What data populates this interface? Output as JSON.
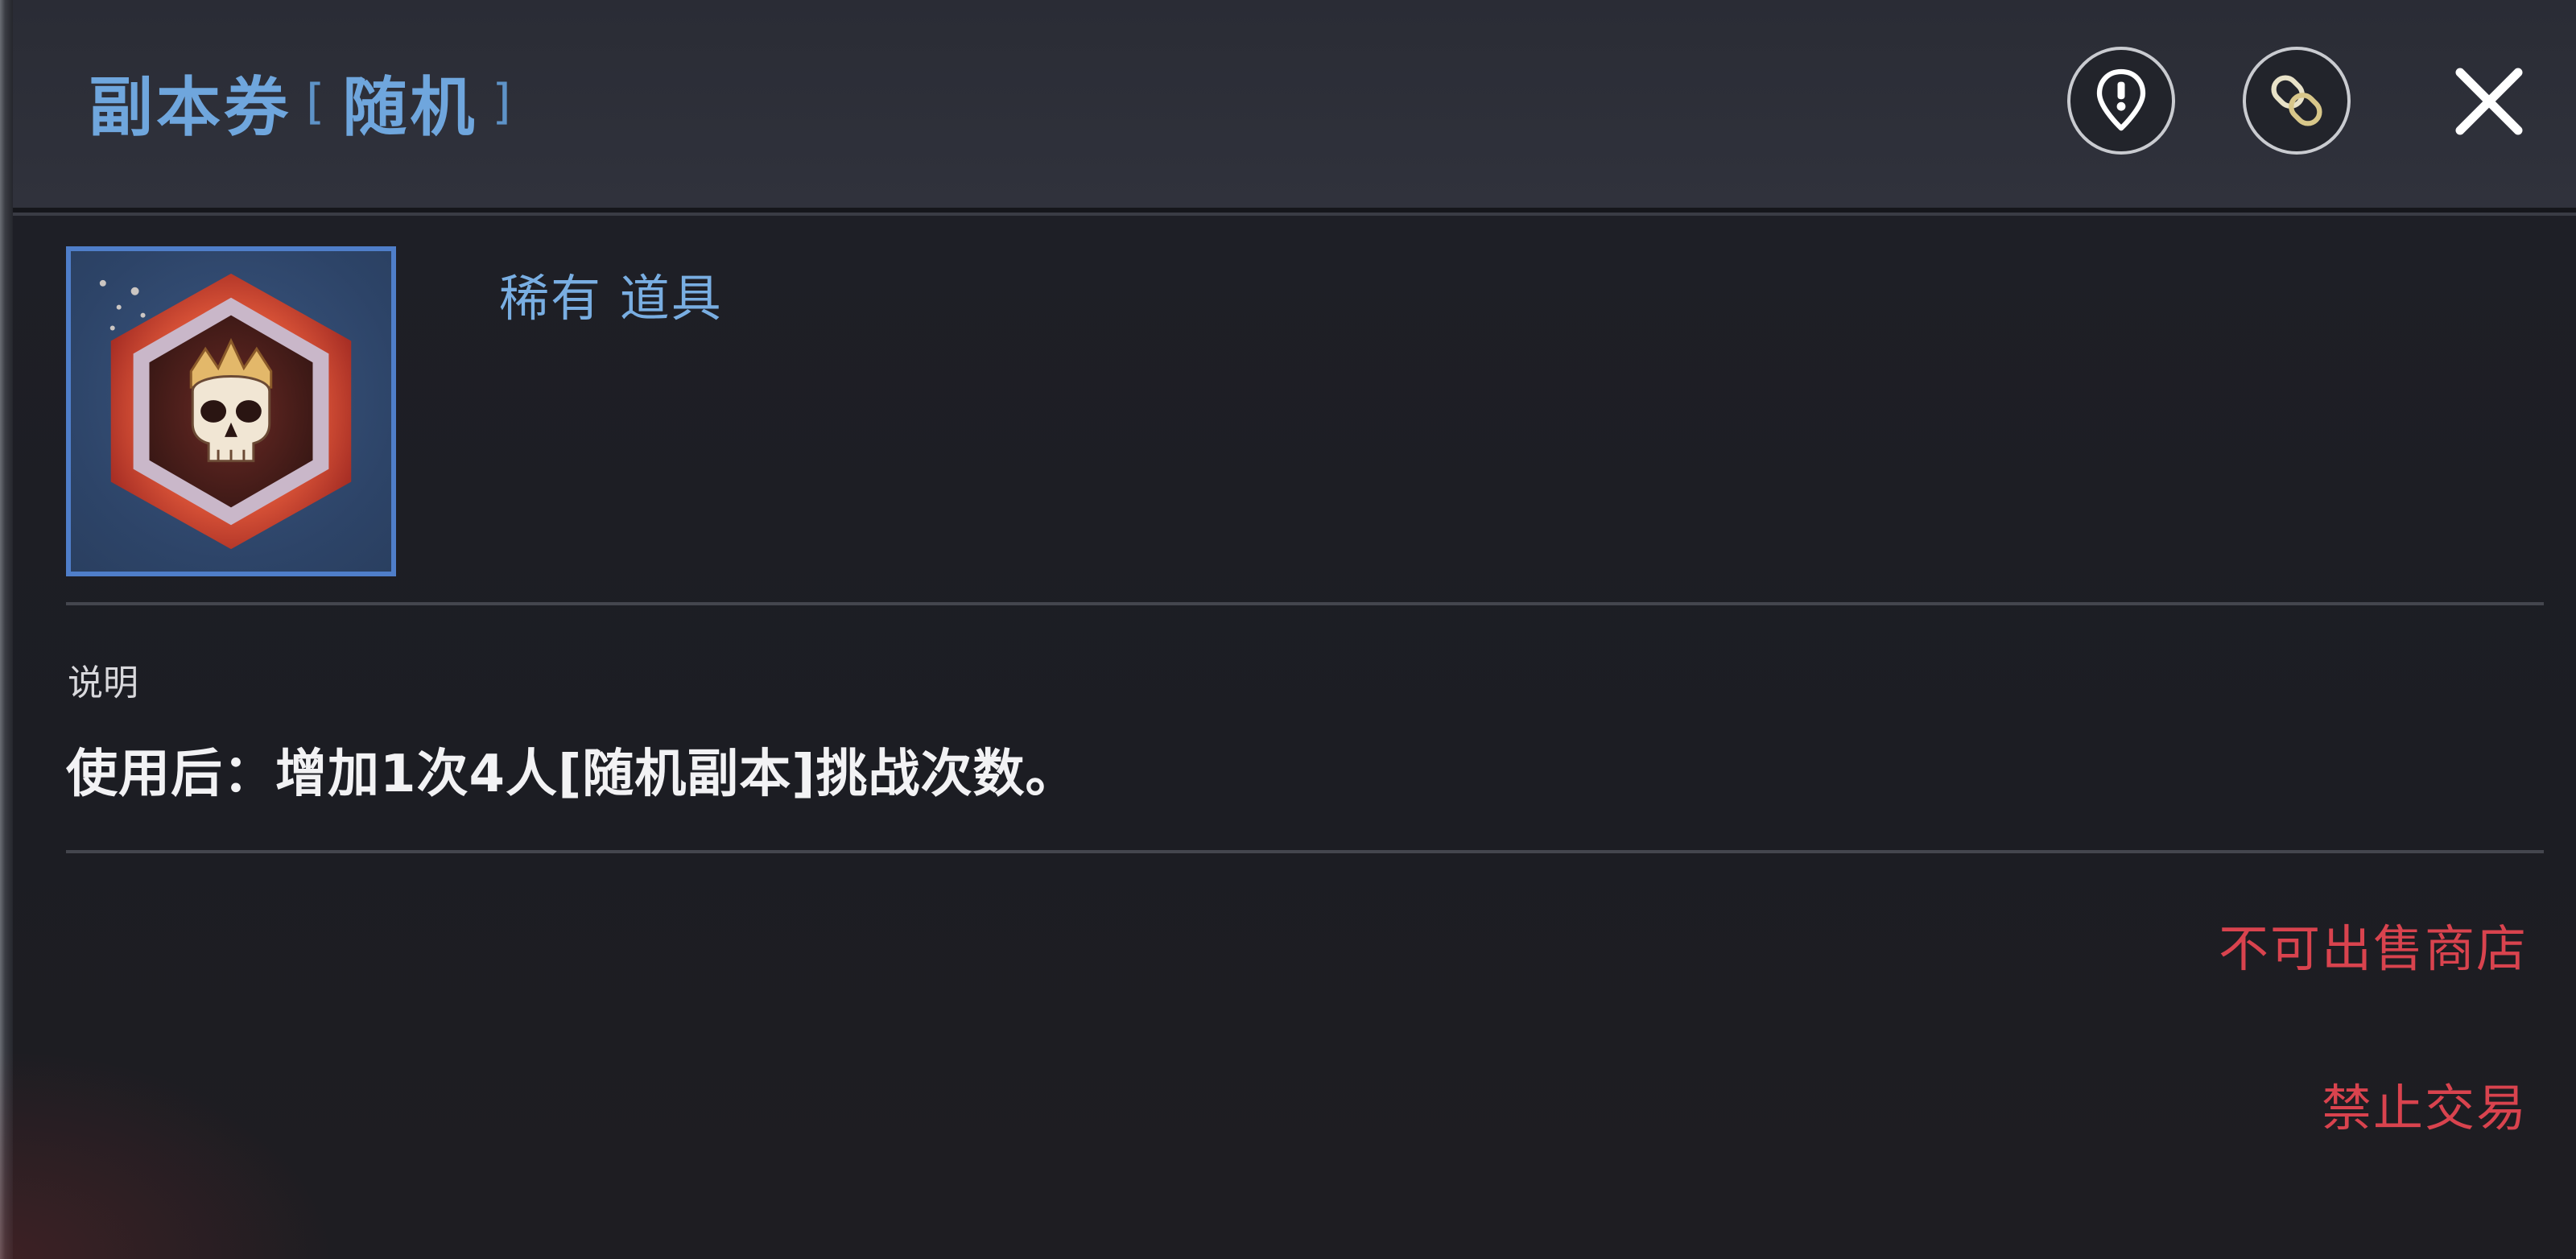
{
  "header": {
    "title_main": "副本券",
    "title_bracket_open": "[",
    "title_sub": "随机",
    "title_bracket_close": "]",
    "buttons": [
      {
        "name": "info-pin-button",
        "icon": "map-pin-exclamation-icon"
      },
      {
        "name": "link-button",
        "icon": "chain-link-icon"
      },
      {
        "name": "close-button",
        "icon": "close-icon"
      }
    ]
  },
  "item": {
    "icon": "crowned-skull-hexagon-emblem",
    "rarity_text": "稀有 道具",
    "frame_color": "#4f7ec9"
  },
  "description": {
    "label": "说明",
    "text": "使用后：增加1次4人[随机副本]挑战次数。"
  },
  "restrictions": {
    "no_shop_sell": "不可出售商店",
    "no_trade": "禁止交易"
  },
  "colors": {
    "title": "#6fa6dd",
    "rarity": "#79aee2",
    "restriction": "#d9434e",
    "background": "#1c1d23"
  }
}
